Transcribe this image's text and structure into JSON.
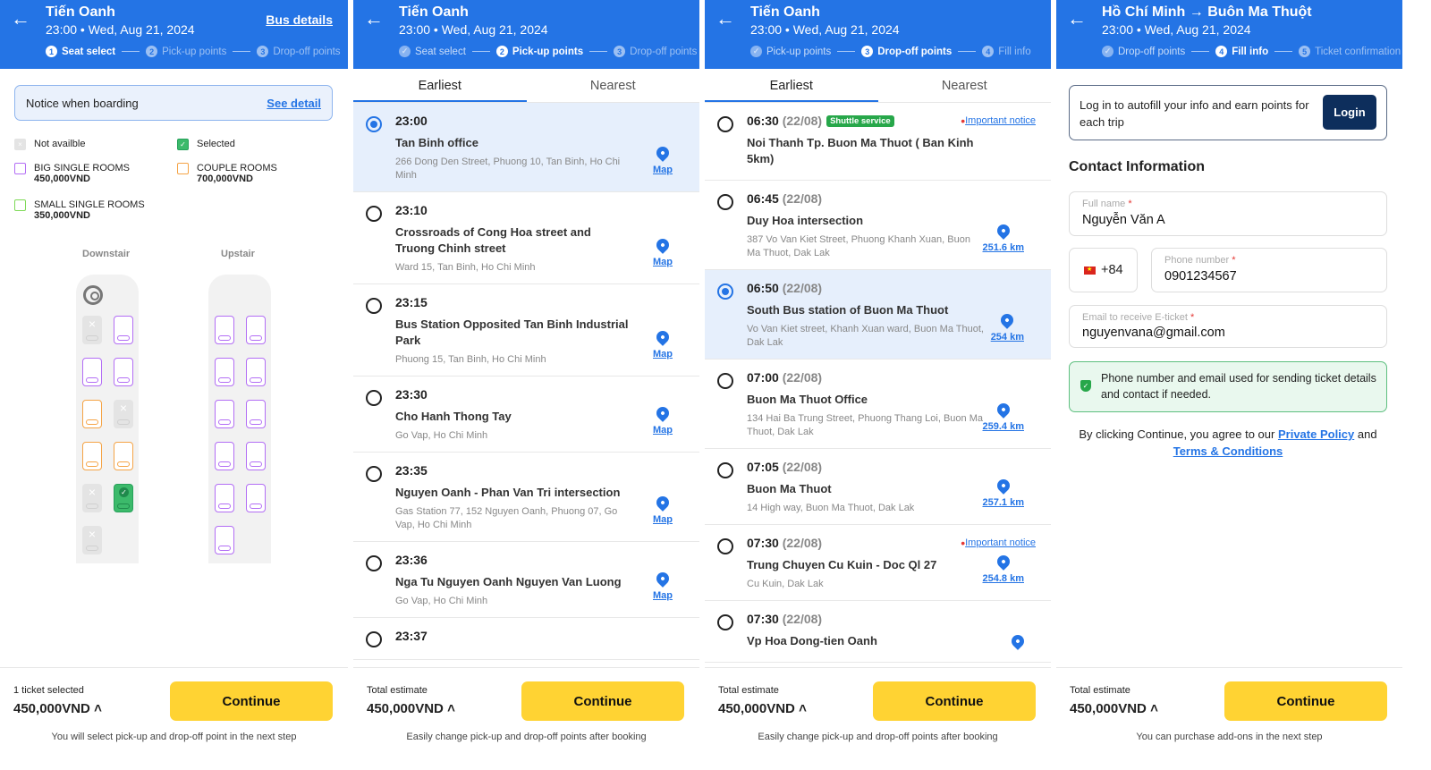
{
  "panel1": {
    "header": {
      "title": "Tiến Oanh",
      "datetime": "23:00 • Wed, Aug 21, 2024",
      "link": "Bus details",
      "steps": [
        {
          "num": "1",
          "label": "Seat select"
        },
        {
          "num": "2",
          "label": "Pick-up points"
        },
        {
          "num": "3",
          "label": "Drop-off points"
        }
      ]
    },
    "notice": {
      "text": "Notice when boarding",
      "link": "See detail"
    },
    "legend": {
      "not_available": "Not availble",
      "selected": "Selected",
      "big": {
        "label": "BIG SINGLE ROOMS",
        "price": "450,000VND"
      },
      "couple": {
        "label": "COUPLE ROOMS",
        "price": "700,000VND"
      },
      "small": {
        "label": "SMALL SINGLE ROOMS",
        "price": "350,000VND"
      }
    },
    "decks": {
      "downstair": "Downstair",
      "upstair": "Upstair"
    },
    "seats_downstair": [
      [
        "na",
        "big"
      ],
      [
        "big",
        "big"
      ],
      [
        "couple",
        "na"
      ],
      [
        "couple",
        "couple"
      ],
      [
        "na",
        "sel"
      ],
      [
        "na",
        ""
      ]
    ],
    "seats_upstair": [
      [
        "big",
        "big"
      ],
      [
        "big",
        "big"
      ],
      [
        "big",
        "big"
      ],
      [
        "big",
        "big"
      ],
      [
        "big",
        "big"
      ],
      [
        "big",
        ""
      ]
    ],
    "footer": {
      "label": "1 ticket selected",
      "price": "450,000VND",
      "button": "Continue",
      "note": "You will select pick-up and drop-off point in the next step"
    }
  },
  "panel2": {
    "header": {
      "title": "Tiến Oanh",
      "datetime": "23:00 • Wed, Aug 21, 2024",
      "steps": [
        {
          "num": "✓",
          "label": "Seat select"
        },
        {
          "num": "2",
          "label": "Pick-up points"
        },
        {
          "num": "3",
          "label": "Drop-off points"
        }
      ]
    },
    "tabs": [
      "Earliest",
      "Nearest"
    ],
    "items": [
      {
        "time": "23:00",
        "name": "Tan Binh office",
        "addr": "266 Dong Den Street, Phuong 10, Tan Binh, Ho Chi Minh",
        "link": "Map",
        "selected": true
      },
      {
        "time": "23:10",
        "name": "Crossroads of Cong Hoa street and Truong Chinh street",
        "addr": "Ward 15, Tan Binh, Ho Chi Minh",
        "link": "Map"
      },
      {
        "time": "23:15",
        "name": "Bus Station Opposited Tan Binh Industrial Park",
        "addr": "Phuong 15, Tan Binh, Ho Chi Minh",
        "link": "Map"
      },
      {
        "time": "23:30",
        "name": "Cho Hanh Thong Tay",
        "addr": "Go Vap, Ho Chi Minh",
        "link": "Map"
      },
      {
        "time": "23:35",
        "name": "Nguyen Oanh - Phan Van Tri intersection",
        "addr": "Gas Station 77, 152 Nguyen Oanh, Phuong 07, Go Vap, Ho Chi Minh",
        "link": "Map"
      },
      {
        "time": "23:36",
        "name": "Nga Tu Nguyen Oanh Nguyen Van Luong",
        "addr": "Go Vap, Ho Chi Minh",
        "link": "Map"
      },
      {
        "time": "23:37",
        "name": "",
        "addr": "",
        "link": ""
      }
    ],
    "footer": {
      "label": "Total estimate",
      "price": "450,000VND",
      "button": "Continue",
      "note": "Easily change pick-up and drop-off points after booking"
    }
  },
  "panel3": {
    "header": {
      "title": "Tiến Oanh",
      "datetime": "23:00 • Wed, Aug 21, 2024",
      "steps": [
        {
          "num": "✓",
          "label": "Pick-up points"
        },
        {
          "num": "3",
          "label": "Drop-off points"
        },
        {
          "num": "4",
          "label": "Fill info"
        }
      ]
    },
    "tabs": [
      "Earliest",
      "Nearest"
    ],
    "items": [
      {
        "time": "06:30",
        "date": "(22/08)",
        "badge": "Shuttle service",
        "notice": "Important notice",
        "name": "Noi Thanh Tp. Buon Ma Thuot ( Ban Kinh 5km)",
        "addr": "",
        "link": ""
      },
      {
        "time": "06:45",
        "date": "(22/08)",
        "name": "Duy Hoa intersection",
        "addr": "387 Vo Van Kiet Street, Phuong Khanh Xuan, Buon Ma Thuot, Dak Lak",
        "link": "251.6 km"
      },
      {
        "time": "06:50",
        "date": "(22/08)",
        "name": "South Bus station of Buon Ma Thuot",
        "addr": "Vo Van Kiet street, Khanh Xuan ward, Buon Ma Thuot, Dak Lak",
        "link": "254 km",
        "selected": true
      },
      {
        "time": "07:00",
        "date": "(22/08)",
        "name": "Buon Ma Thuot Office",
        "addr": "134 Hai Ba Trung Street, Phuong Thang Loi, Buon Ma Thuot, Dak Lak",
        "link": "259.4 km"
      },
      {
        "time": "07:05",
        "date": "(22/08)",
        "name": "Buon Ma Thuot",
        "addr": "14 High way, Buon Ma Thuot, Dak Lak",
        "link": "257.1 km"
      },
      {
        "time": "07:30",
        "date": "(22/08)",
        "notice": "Important notice",
        "name": "Trung Chuyen Cu Kuin - Doc Ql 27",
        "addr": "Cu Kuin, Dak Lak",
        "link": "254.8 km"
      },
      {
        "time": "07:30",
        "date": "(22/08)",
        "name": "Vp Hoa Dong-tien Oanh",
        "addr": "",
        "link": ""
      }
    ],
    "footer": {
      "label": "Total estimate",
      "price": "450,000VND",
      "button": "Continue",
      "note": "Easily change pick-up and drop-off points after booking"
    }
  },
  "panel4": {
    "header": {
      "title": "Hồ Chí Minh → Buôn Ma Thuột",
      "datetime": "23:00 • Wed, Aug 21, 2024",
      "steps": [
        {
          "num": "✓",
          "label": "Drop-off points"
        },
        {
          "num": "4",
          "label": "Fill info"
        },
        {
          "num": "5",
          "label": "Ticket confirmation"
        }
      ]
    },
    "login": {
      "text": "Log in to autofill your info and earn points for each trip",
      "button": "Login"
    },
    "contact_title": "Contact Information",
    "fullname": {
      "label": "Full name",
      "value": "Nguyễn Văn A"
    },
    "country_code": "+84",
    "phone": {
      "label": "Phone number",
      "value": "0901234567"
    },
    "email": {
      "label": "Email to receive E-ticket",
      "value": "nguyenvana@gmail.com"
    },
    "info": "Phone number and email used for sending ticket details and contact if needed.",
    "agree": {
      "prefix": "By clicking Continue, you agree to our",
      "policy": "Private Policy",
      "and": "and",
      "terms": "Terms & Conditions"
    },
    "footer": {
      "label": "Total estimate",
      "price": "450,000VND",
      "button": "Continue",
      "note": "You can purchase add-ons in the next step"
    }
  }
}
